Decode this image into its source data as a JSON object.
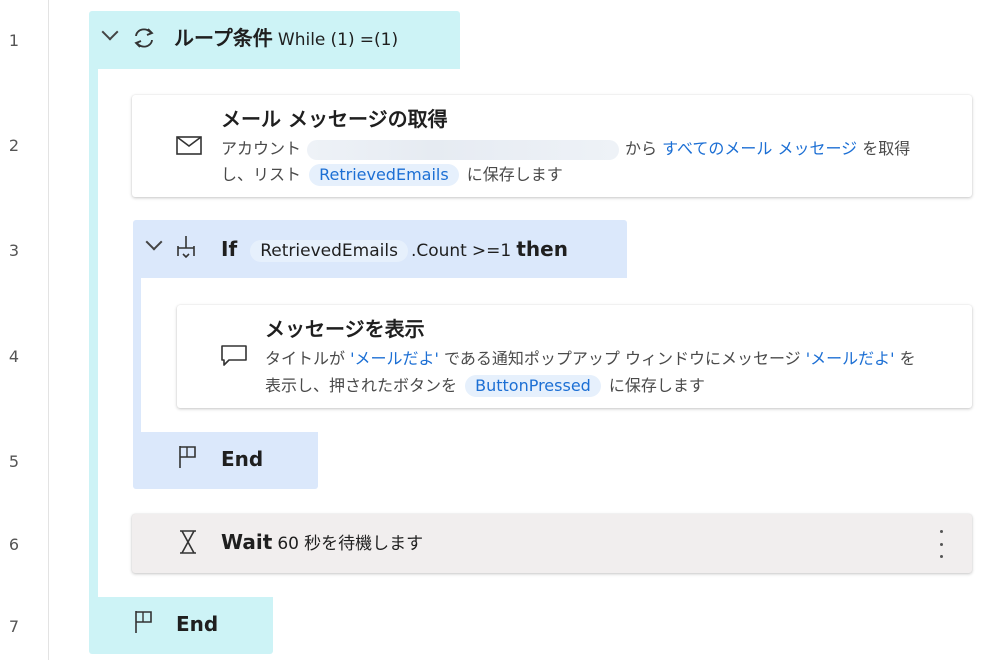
{
  "line_numbers": [
    "1",
    "2",
    "3",
    "4",
    "5",
    "6",
    "7"
  ],
  "loop": {
    "title": "ループ条件",
    "keyword": "While",
    "left_operand": "(1)",
    "operator": "=",
    "right_operand": "(1)",
    "end_label": "End"
  },
  "get_mail": {
    "title": "メール メッセージの取得",
    "prefix": "アカウント",
    "from": "から",
    "target": "すべてのメール メッセージ",
    "suffix1": "を取得",
    "line2_prefix": "し、リスト",
    "variable": "RetrievedEmails",
    "line2_suffix": "に保存します"
  },
  "if_block": {
    "keyword": "If",
    "variable": "RetrievedEmails",
    "property": ".Count",
    "operator": ">=",
    "value": "1",
    "then": "then",
    "end_label": "End"
  },
  "show_message": {
    "title": "メッセージを表示",
    "line1_prefix": "タイトルが",
    "title_value": "'メールだよ'",
    "line1_mid": "である通知ポップアップ ウィンドウにメッセージ",
    "message_value": "'メールだよ'",
    "line1_suffix": "を",
    "line2_prefix": "表示し、押されたボタンを",
    "variable": "ButtonPressed",
    "line2_suffix": "に保存します"
  },
  "wait": {
    "label": "Wait",
    "seconds": "60",
    "suffix": "秒を待機します"
  },
  "colors": {
    "loop_bg": "#cdf3f6",
    "if_bg": "#dbe8fb",
    "accent_blue": "#1c6fd4",
    "wait_bg": "#f1eeee"
  }
}
